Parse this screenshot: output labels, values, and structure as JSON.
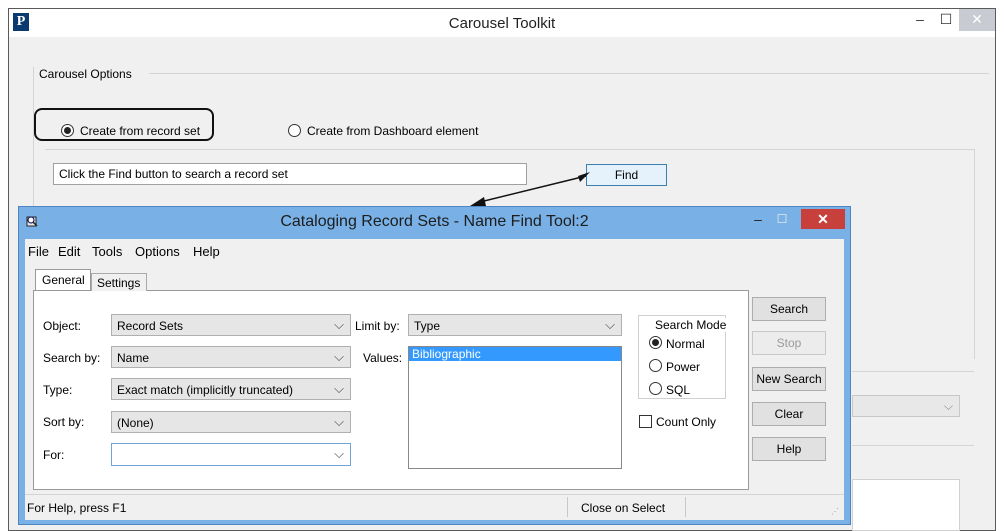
{
  "window": {
    "title": "Carousel Toolkit",
    "logo": "P",
    "min_glyph": "–",
    "max_glyph": "☐",
    "close_glyph": "✕"
  },
  "options": {
    "group_label": "Carousel Options",
    "radio_record_set": "Create from record set",
    "radio_dashboard": "Create from Dashboard element",
    "find_hint": "Click the Find button to search a record set",
    "find_button": "Find"
  },
  "dialog": {
    "title": "Cataloging Record Sets - Name Find Tool:2",
    "min_glyph": "–",
    "max_glyph": "☐",
    "close_glyph": "✕",
    "menu": [
      "File",
      "Edit",
      "Tools",
      "Options",
      "Help"
    ],
    "tabs": [
      "General",
      "Settings"
    ],
    "fields": {
      "object_label": "Object:",
      "object_value": "Record Sets",
      "search_by_label": "Search by:",
      "search_by_value": "Name",
      "type_label": "Type:",
      "type_value": "Exact match (implicitly truncated)",
      "sort_by_label": "Sort by:",
      "sort_by_value": "(None)",
      "for_label": "For:",
      "for_value": "",
      "limit_by_label": "Limit by:",
      "limit_by_value": "Type",
      "values_label": "Values:",
      "values_selected": "Bibliographic"
    },
    "search_mode": {
      "title": "Search Mode",
      "options": [
        "Normal",
        "Power",
        "SQL"
      ],
      "selected": "Normal"
    },
    "count_only": "Count Only",
    "buttons": {
      "search": "Search",
      "stop": "Stop",
      "new_search": "New Search",
      "clear": "Clear",
      "help": "Help"
    },
    "status": {
      "help_text": "For Help, press F1",
      "close_on_select": "Close on Select"
    }
  },
  "colors": {
    "dialog_frame": "#79b1e6",
    "close_red": "#c7403c",
    "selection": "#3399ff"
  }
}
